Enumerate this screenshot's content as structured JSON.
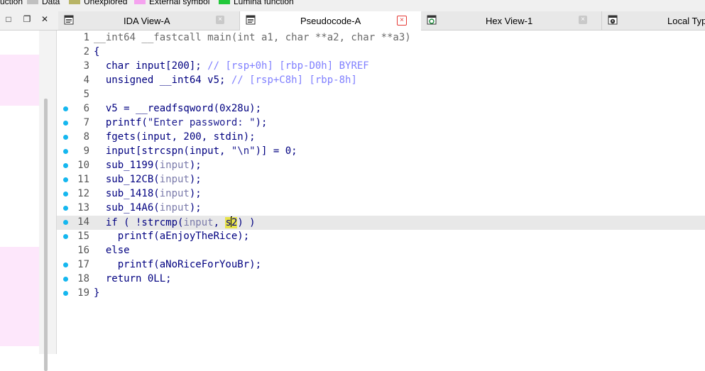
{
  "legend": {
    "items": [
      {
        "label": "uction",
        "color": ""
      },
      {
        "label": "Data",
        "color": "#c0c0c0"
      },
      {
        "label": "Unexplored",
        "color": "#b8b466"
      },
      {
        "label": "External symbol",
        "color": "#f5a3ef"
      },
      {
        "label": "Lumina function",
        "color": "#22c83a"
      }
    ]
  },
  "tabs": [
    {
      "label": "IDA View-A",
      "icon": "ida-view-icon",
      "close": "×",
      "active": false
    },
    {
      "label": "Pseudocode-A",
      "icon": "pseudocode-icon",
      "close": "×",
      "active": true
    },
    {
      "label": "Hex View-1",
      "icon": "hex-view-icon",
      "close": "×",
      "active": false
    },
    {
      "label": "Local Typ",
      "icon": "local-types-icon",
      "close": "",
      "active": false
    }
  ],
  "window_buttons": {
    "maximize": "□",
    "restore": "❐",
    "close": "✕"
  },
  "colors": {
    "accent_close": "#e53935",
    "breakpoint": "#15b7ef",
    "highlight_line": "#e8e8e8",
    "nav_pink": "#fde7fb"
  },
  "code": {
    "lines": [
      {
        "n": "1",
        "bp": false,
        "hl": false,
        "segs": [
          {
            "t": "__int64 __fastcall main(int a1, char **a2, char **a3)",
            "c": "gray"
          }
        ]
      },
      {
        "n": "2",
        "bp": false,
        "hl": false,
        "segs": [
          {
            "t": "{",
            "c": ""
          }
        ]
      },
      {
        "n": "3",
        "bp": false,
        "hl": false,
        "segs": [
          {
            "t": "  char input[200]; ",
            "c": ""
          },
          {
            "t": "// [rsp+0h] [rbp-D0h] BYREF",
            "c": "cmt"
          }
        ]
      },
      {
        "n": "4",
        "bp": false,
        "hl": false,
        "segs": [
          {
            "t": "  unsigned __int64 v5; ",
            "c": ""
          },
          {
            "t": "// [rsp+C8h] [rbp-8h]",
            "c": "cmt"
          }
        ]
      },
      {
        "n": "5",
        "bp": false,
        "hl": false,
        "segs": []
      },
      {
        "n": "6",
        "bp": true,
        "hl": false,
        "segs": [
          {
            "t": "  v5 = __readfsqword(0x28u);",
            "c": ""
          }
        ]
      },
      {
        "n": "7",
        "bp": true,
        "hl": false,
        "segs": [
          {
            "t": "  printf(",
            "c": ""
          },
          {
            "t": "\"Enter password: \"",
            "c": "str"
          },
          {
            "t": ");",
            "c": ""
          }
        ]
      },
      {
        "n": "8",
        "bp": true,
        "hl": false,
        "segs": [
          {
            "t": "  fgets(input, 200, stdin);",
            "c": ""
          }
        ]
      },
      {
        "n": "9",
        "bp": true,
        "hl": false,
        "segs": [
          {
            "t": "  input[strcspn(input, ",
            "c": ""
          },
          {
            "t": "\"\\n\"",
            "c": "str"
          },
          {
            "t": ")] = 0;",
            "c": ""
          }
        ]
      },
      {
        "n": "10",
        "bp": true,
        "hl": false,
        "segs": [
          {
            "t": "  sub_1199(",
            "c": ""
          },
          {
            "t": "input",
            "c": "var"
          },
          {
            "t": ");",
            "c": ""
          }
        ]
      },
      {
        "n": "11",
        "bp": true,
        "hl": false,
        "segs": [
          {
            "t": "  sub_12CB(",
            "c": ""
          },
          {
            "t": "input",
            "c": "var"
          },
          {
            "t": ");",
            "c": ""
          }
        ]
      },
      {
        "n": "12",
        "bp": true,
        "hl": false,
        "segs": [
          {
            "t": "  sub_1418(",
            "c": ""
          },
          {
            "t": "input",
            "c": "var"
          },
          {
            "t": ");",
            "c": ""
          }
        ]
      },
      {
        "n": "13",
        "bp": true,
        "hl": false,
        "segs": [
          {
            "t": "  sub_14A6(",
            "c": ""
          },
          {
            "t": "input",
            "c": "var"
          },
          {
            "t": ");",
            "c": ""
          }
        ]
      },
      {
        "n": "14",
        "bp": true,
        "hl": true,
        "segs": [
          {
            "t": "  if ( !strcmp(",
            "c": ""
          },
          {
            "t": "input",
            "c": "var"
          },
          {
            "t": ", ",
            "c": ""
          },
          {
            "t": "s",
            "c": "cur"
          },
          {
            "t": "",
            "c": "caret"
          },
          {
            "t": "2",
            "c": "cur"
          },
          {
            "t": ") )",
            "c": ""
          }
        ]
      },
      {
        "n": "15",
        "bp": true,
        "hl": false,
        "segs": [
          {
            "t": "    printf(aEnjoyTheRice);",
            "c": ""
          }
        ]
      },
      {
        "n": "16",
        "bp": false,
        "hl": false,
        "segs": [
          {
            "t": "  else",
            "c": ""
          }
        ]
      },
      {
        "n": "17",
        "bp": true,
        "hl": false,
        "segs": [
          {
            "t": "    printf(aNoRiceForYouBr);",
            "c": ""
          }
        ]
      },
      {
        "n": "18",
        "bp": true,
        "hl": false,
        "segs": [
          {
            "t": "  return 0LL;",
            "c": ""
          }
        ]
      },
      {
        "n": "19",
        "bp": true,
        "hl": false,
        "segs": [
          {
            "t": "}",
            "c": ""
          }
        ]
      }
    ]
  }
}
